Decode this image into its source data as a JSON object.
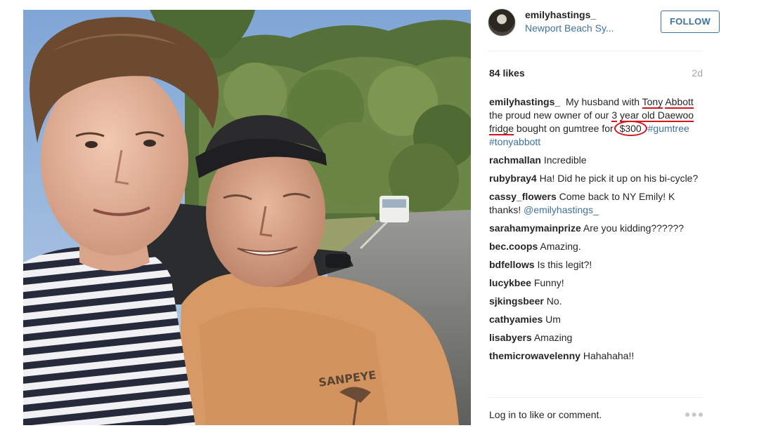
{
  "post": {
    "username": "emilyhastings_",
    "location": "Newport Beach Sy...",
    "follow_label": "FOLLOW",
    "likes": "84 likes",
    "age": "2d",
    "caption": {
      "user": "emilyhastings_",
      "t1": "My husband with ",
      "t2": "Tony",
      "t3": "Abbott",
      "t4": " the proud new owner of our ",
      "t5": "3",
      "t6": "year old Daewoo fridge",
      "t7": " bought on gumtree for ",
      "t8": "$300",
      "t9": " ",
      "tag1": "#gumtree",
      "tag2": "#tonyabbott"
    },
    "comments": [
      {
        "user": "rachmallan",
        "text": "Incredible"
      },
      {
        "user": "rubybray4",
        "text": "Ha! Did he pick it up on his bi-cycle?"
      },
      {
        "user": "cassy_flowers",
        "text": "Come back to NY Emily! K thanks! ",
        "mention": "@emilyhastings_"
      },
      {
        "user": "sarahamymainprize",
        "text": "Are you kidding??????"
      },
      {
        "user": "bec.coops",
        "text": "Amazing."
      },
      {
        "user": "bdfellows",
        "text": "Is this legit?!"
      },
      {
        "user": "lucykbee",
        "text": "Funny!"
      },
      {
        "user": "sjkingsbeer",
        "text": "No."
      },
      {
        "user": "cathyamies",
        "text": "Um"
      },
      {
        "user": "lisabyers",
        "text": "Amazing"
      },
      {
        "user": "themicrowavelenny",
        "text": "Hahahaha!!"
      }
    ],
    "login_text": "Log in to like or comment.",
    "more_icon": "ellipsis-icon",
    "shirt_text": "SANPEYE"
  },
  "colors": {
    "link": "#3f729b",
    "annotation": "#d4161c"
  }
}
